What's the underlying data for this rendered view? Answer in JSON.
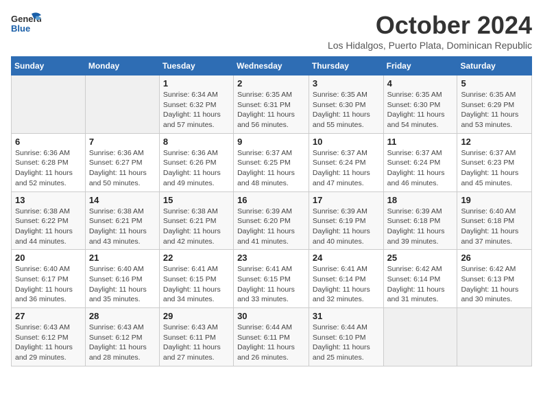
{
  "header": {
    "logo": {
      "line1": "General",
      "line2": "Blue"
    },
    "title": "October 2024",
    "subtitle": "Los Hidalgos, Puerto Plata, Dominican Republic"
  },
  "weekdays": [
    "Sunday",
    "Monday",
    "Tuesday",
    "Wednesday",
    "Thursday",
    "Friday",
    "Saturday"
  ],
  "weeks": [
    [
      {
        "day": "",
        "info": ""
      },
      {
        "day": "",
        "info": ""
      },
      {
        "day": "1",
        "info": "Sunrise: 6:34 AM\nSunset: 6:32 PM\nDaylight: 11 hours and 57 minutes."
      },
      {
        "day": "2",
        "info": "Sunrise: 6:35 AM\nSunset: 6:31 PM\nDaylight: 11 hours and 56 minutes."
      },
      {
        "day": "3",
        "info": "Sunrise: 6:35 AM\nSunset: 6:30 PM\nDaylight: 11 hours and 55 minutes."
      },
      {
        "day": "4",
        "info": "Sunrise: 6:35 AM\nSunset: 6:30 PM\nDaylight: 11 hours and 54 minutes."
      },
      {
        "day": "5",
        "info": "Sunrise: 6:35 AM\nSunset: 6:29 PM\nDaylight: 11 hours and 53 minutes."
      }
    ],
    [
      {
        "day": "6",
        "info": "Sunrise: 6:36 AM\nSunset: 6:28 PM\nDaylight: 11 hours and 52 minutes."
      },
      {
        "day": "7",
        "info": "Sunrise: 6:36 AM\nSunset: 6:27 PM\nDaylight: 11 hours and 50 minutes."
      },
      {
        "day": "8",
        "info": "Sunrise: 6:36 AM\nSunset: 6:26 PM\nDaylight: 11 hours and 49 minutes."
      },
      {
        "day": "9",
        "info": "Sunrise: 6:37 AM\nSunset: 6:25 PM\nDaylight: 11 hours and 48 minutes."
      },
      {
        "day": "10",
        "info": "Sunrise: 6:37 AM\nSunset: 6:24 PM\nDaylight: 11 hours and 47 minutes."
      },
      {
        "day": "11",
        "info": "Sunrise: 6:37 AM\nSunset: 6:24 PM\nDaylight: 11 hours and 46 minutes."
      },
      {
        "day": "12",
        "info": "Sunrise: 6:37 AM\nSunset: 6:23 PM\nDaylight: 11 hours and 45 minutes."
      }
    ],
    [
      {
        "day": "13",
        "info": "Sunrise: 6:38 AM\nSunset: 6:22 PM\nDaylight: 11 hours and 44 minutes."
      },
      {
        "day": "14",
        "info": "Sunrise: 6:38 AM\nSunset: 6:21 PM\nDaylight: 11 hours and 43 minutes."
      },
      {
        "day": "15",
        "info": "Sunrise: 6:38 AM\nSunset: 6:21 PM\nDaylight: 11 hours and 42 minutes."
      },
      {
        "day": "16",
        "info": "Sunrise: 6:39 AM\nSunset: 6:20 PM\nDaylight: 11 hours and 41 minutes."
      },
      {
        "day": "17",
        "info": "Sunrise: 6:39 AM\nSunset: 6:19 PM\nDaylight: 11 hours and 40 minutes."
      },
      {
        "day": "18",
        "info": "Sunrise: 6:39 AM\nSunset: 6:18 PM\nDaylight: 11 hours and 39 minutes."
      },
      {
        "day": "19",
        "info": "Sunrise: 6:40 AM\nSunset: 6:18 PM\nDaylight: 11 hours and 37 minutes."
      }
    ],
    [
      {
        "day": "20",
        "info": "Sunrise: 6:40 AM\nSunset: 6:17 PM\nDaylight: 11 hours and 36 minutes."
      },
      {
        "day": "21",
        "info": "Sunrise: 6:40 AM\nSunset: 6:16 PM\nDaylight: 11 hours and 35 minutes."
      },
      {
        "day": "22",
        "info": "Sunrise: 6:41 AM\nSunset: 6:15 PM\nDaylight: 11 hours and 34 minutes."
      },
      {
        "day": "23",
        "info": "Sunrise: 6:41 AM\nSunset: 6:15 PM\nDaylight: 11 hours and 33 minutes."
      },
      {
        "day": "24",
        "info": "Sunrise: 6:41 AM\nSunset: 6:14 PM\nDaylight: 11 hours and 32 minutes."
      },
      {
        "day": "25",
        "info": "Sunrise: 6:42 AM\nSunset: 6:14 PM\nDaylight: 11 hours and 31 minutes."
      },
      {
        "day": "26",
        "info": "Sunrise: 6:42 AM\nSunset: 6:13 PM\nDaylight: 11 hours and 30 minutes."
      }
    ],
    [
      {
        "day": "27",
        "info": "Sunrise: 6:43 AM\nSunset: 6:12 PM\nDaylight: 11 hours and 29 minutes."
      },
      {
        "day": "28",
        "info": "Sunrise: 6:43 AM\nSunset: 6:12 PM\nDaylight: 11 hours and 28 minutes."
      },
      {
        "day": "29",
        "info": "Sunrise: 6:43 AM\nSunset: 6:11 PM\nDaylight: 11 hours and 27 minutes."
      },
      {
        "day": "30",
        "info": "Sunrise: 6:44 AM\nSunset: 6:11 PM\nDaylight: 11 hours and 26 minutes."
      },
      {
        "day": "31",
        "info": "Sunrise: 6:44 AM\nSunset: 6:10 PM\nDaylight: 11 hours and 25 minutes."
      },
      {
        "day": "",
        "info": ""
      },
      {
        "day": "",
        "info": ""
      }
    ]
  ]
}
